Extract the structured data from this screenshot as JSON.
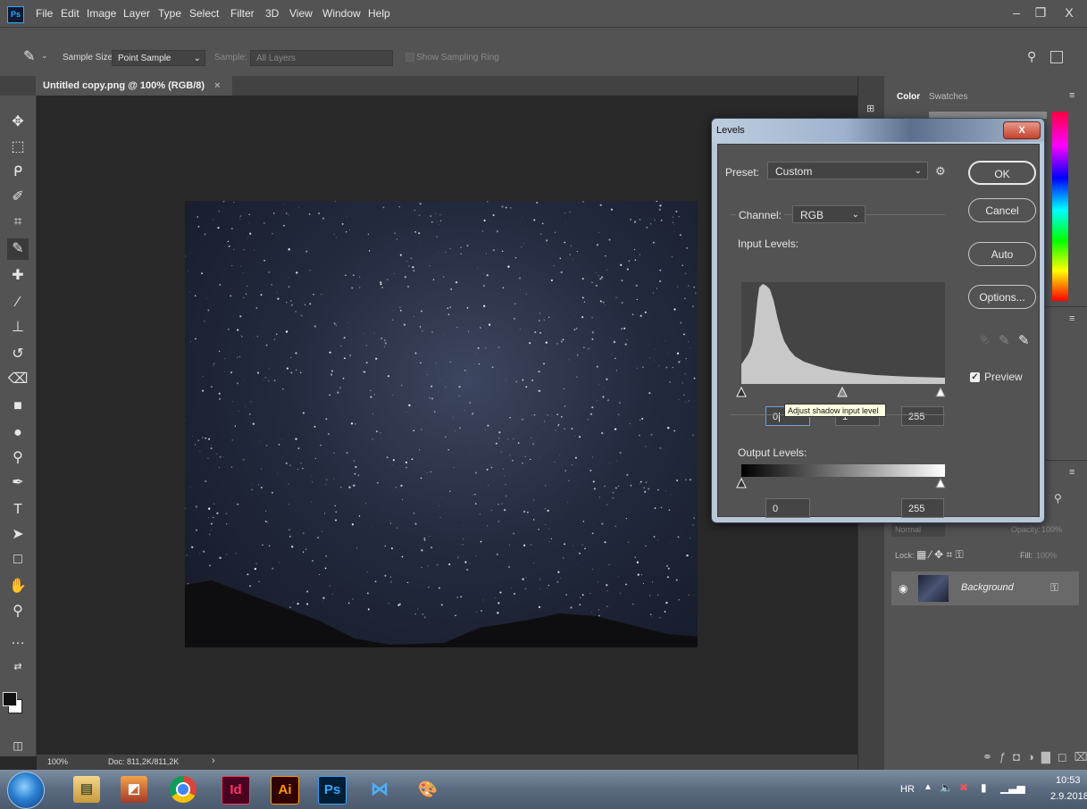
{
  "app": {
    "logo": "Ps"
  },
  "menu": [
    "File",
    "Edit",
    "Image",
    "Layer",
    "Type",
    "Select",
    "Filter",
    "3D",
    "View",
    "Window",
    "Help"
  ],
  "window_buttons": {
    "minimize": "–",
    "restore": "❐",
    "close": "X"
  },
  "options_bar": {
    "sample_size_label": "Sample Size:",
    "sample_size_value": "Point Sample",
    "sample_label": "Sample:",
    "sample_value": "All Layers",
    "show_ring_label": "Show Sampling Ring"
  },
  "document_tab": {
    "title": "Untitled copy.png @ 100% (RGB/8)",
    "close": "×"
  },
  "status": {
    "zoom": "100%",
    "doc": "Doc: 811,2K/811,2K"
  },
  "panels": {
    "color_tab": "Color",
    "swatches_tab": "Swatches",
    "layers": {
      "blend_mode": "Normal",
      "opacity_label": "Opacity:",
      "opacity_value": "100%",
      "lock_label": "Lock:",
      "fill_label": "Fill:",
      "fill_value": "100%",
      "layer_name": "Background"
    }
  },
  "levels_dialog": {
    "title": "Levels",
    "close": "X",
    "preset_label": "Preset:",
    "preset_value": "Custom",
    "channel_label": "Channel:",
    "channel_value": "RGB",
    "input_levels_label": "Input Levels:",
    "input_shadow": "0",
    "input_midtone": "1",
    "input_highlight": "255",
    "output_levels_label": "Output Levels:",
    "output_shadow": "0",
    "output_highlight": "255",
    "buttons": {
      "ok": "OK",
      "cancel": "Cancel",
      "auto": "Auto",
      "options": "Options..."
    },
    "preview_label": "Preview",
    "preview_checked": true,
    "tooltip": "Adjust shadow input level"
  },
  "taskbar": {
    "apps": [
      "Id",
      "Ai",
      "Ps"
    ],
    "language": "HR",
    "time": "10:53",
    "date": "2.9.2018."
  },
  "colors": {
    "ui_bg": "#535353",
    "canvas_bg": "#282828",
    "ps_blue": "#31a8ff",
    "id_pink": "#ff3366",
    "ai_orange": "#ff9a00"
  }
}
